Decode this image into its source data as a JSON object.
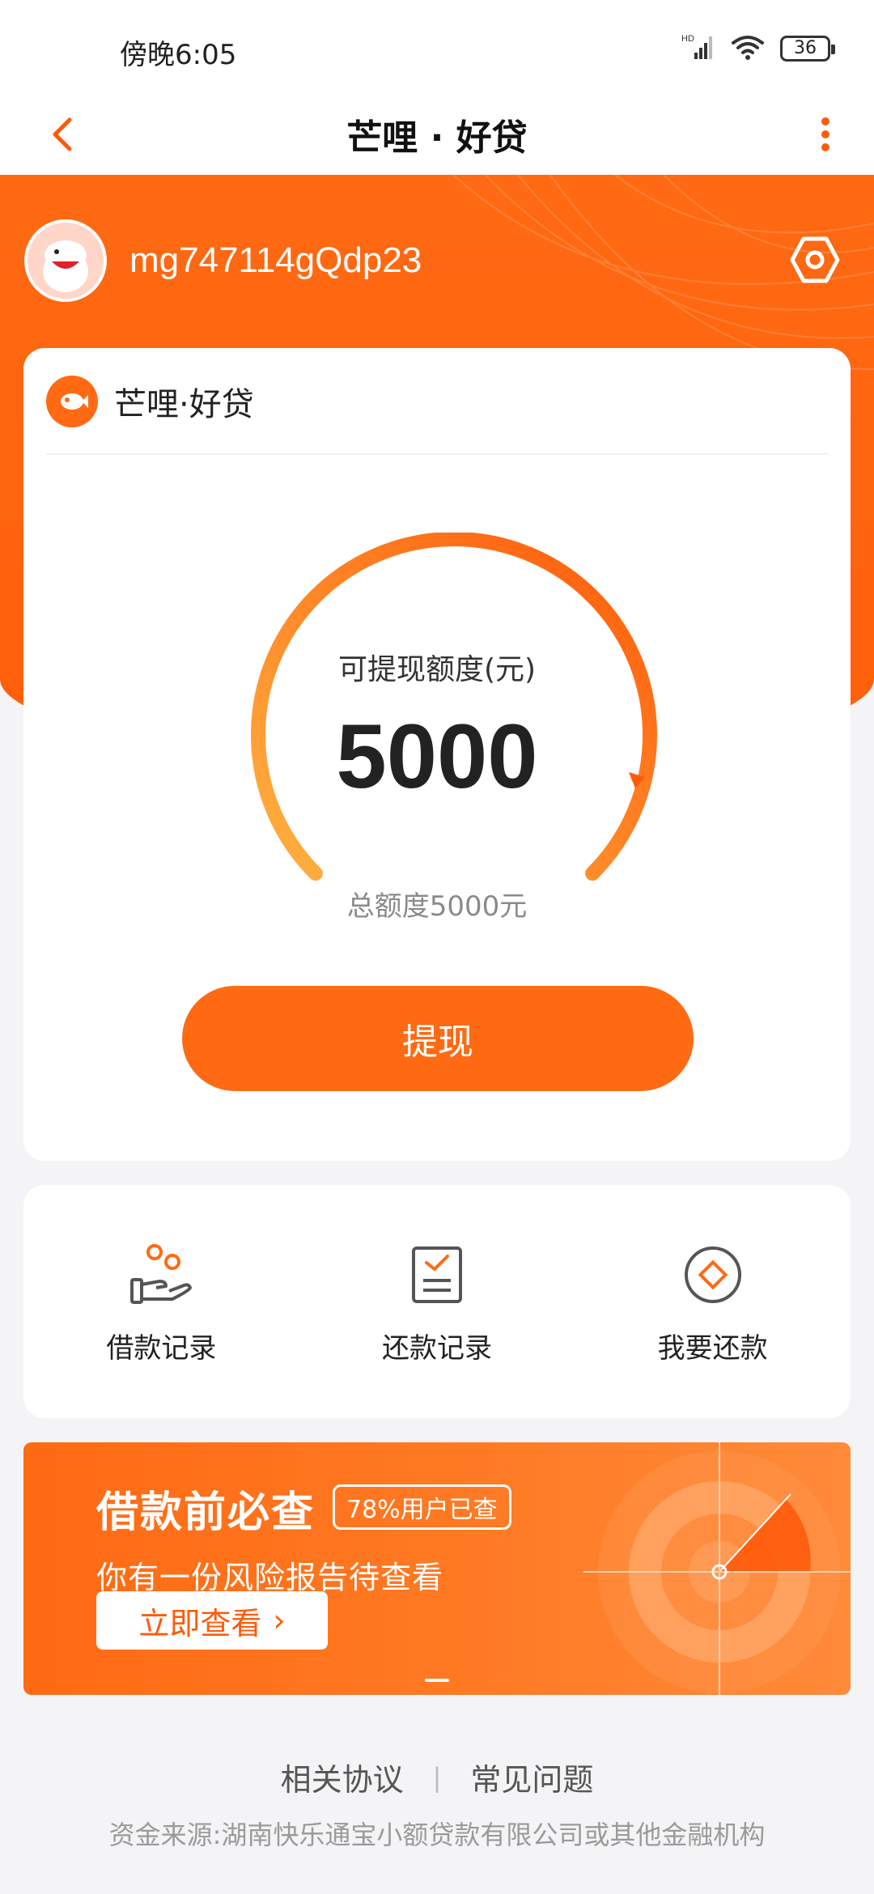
{
  "status": {
    "time": "傍晚6:05",
    "battery": "36",
    "network": "HD"
  },
  "nav": {
    "title": "芒哩 · 好贷"
  },
  "profile": {
    "username": "mg747114gQdp23"
  },
  "loan_card": {
    "brand": "芒哩·好贷",
    "available_label": "可提现额度(元)",
    "available_value": "5000",
    "total_label": "总额度5000元",
    "withdraw_label": "提现",
    "gauge_progress": 1.0
  },
  "actions": [
    {
      "label": "借款记录",
      "icon": "coin-hand-icon"
    },
    {
      "label": "还款记录",
      "icon": "checklist-icon"
    },
    {
      "label": "我要还款",
      "icon": "diamond-circle-icon"
    }
  ],
  "banner": {
    "title": "借款前必查",
    "badge": "78%用户已查",
    "subtitle": "你有一份风险报告待查看",
    "button_label": "立即查看",
    "button_arrow": "›"
  },
  "footer": {
    "link_agreement": "相关协议",
    "separator": "|",
    "link_faq": "常见问题",
    "note": "资金来源:湖南快乐通宝小额贷款有限公司或其他金融机构"
  },
  "colors": {
    "accent": "#ff6a13",
    "gauge_start": "#ffb142",
    "gauge_end": "#ff5a0a"
  }
}
